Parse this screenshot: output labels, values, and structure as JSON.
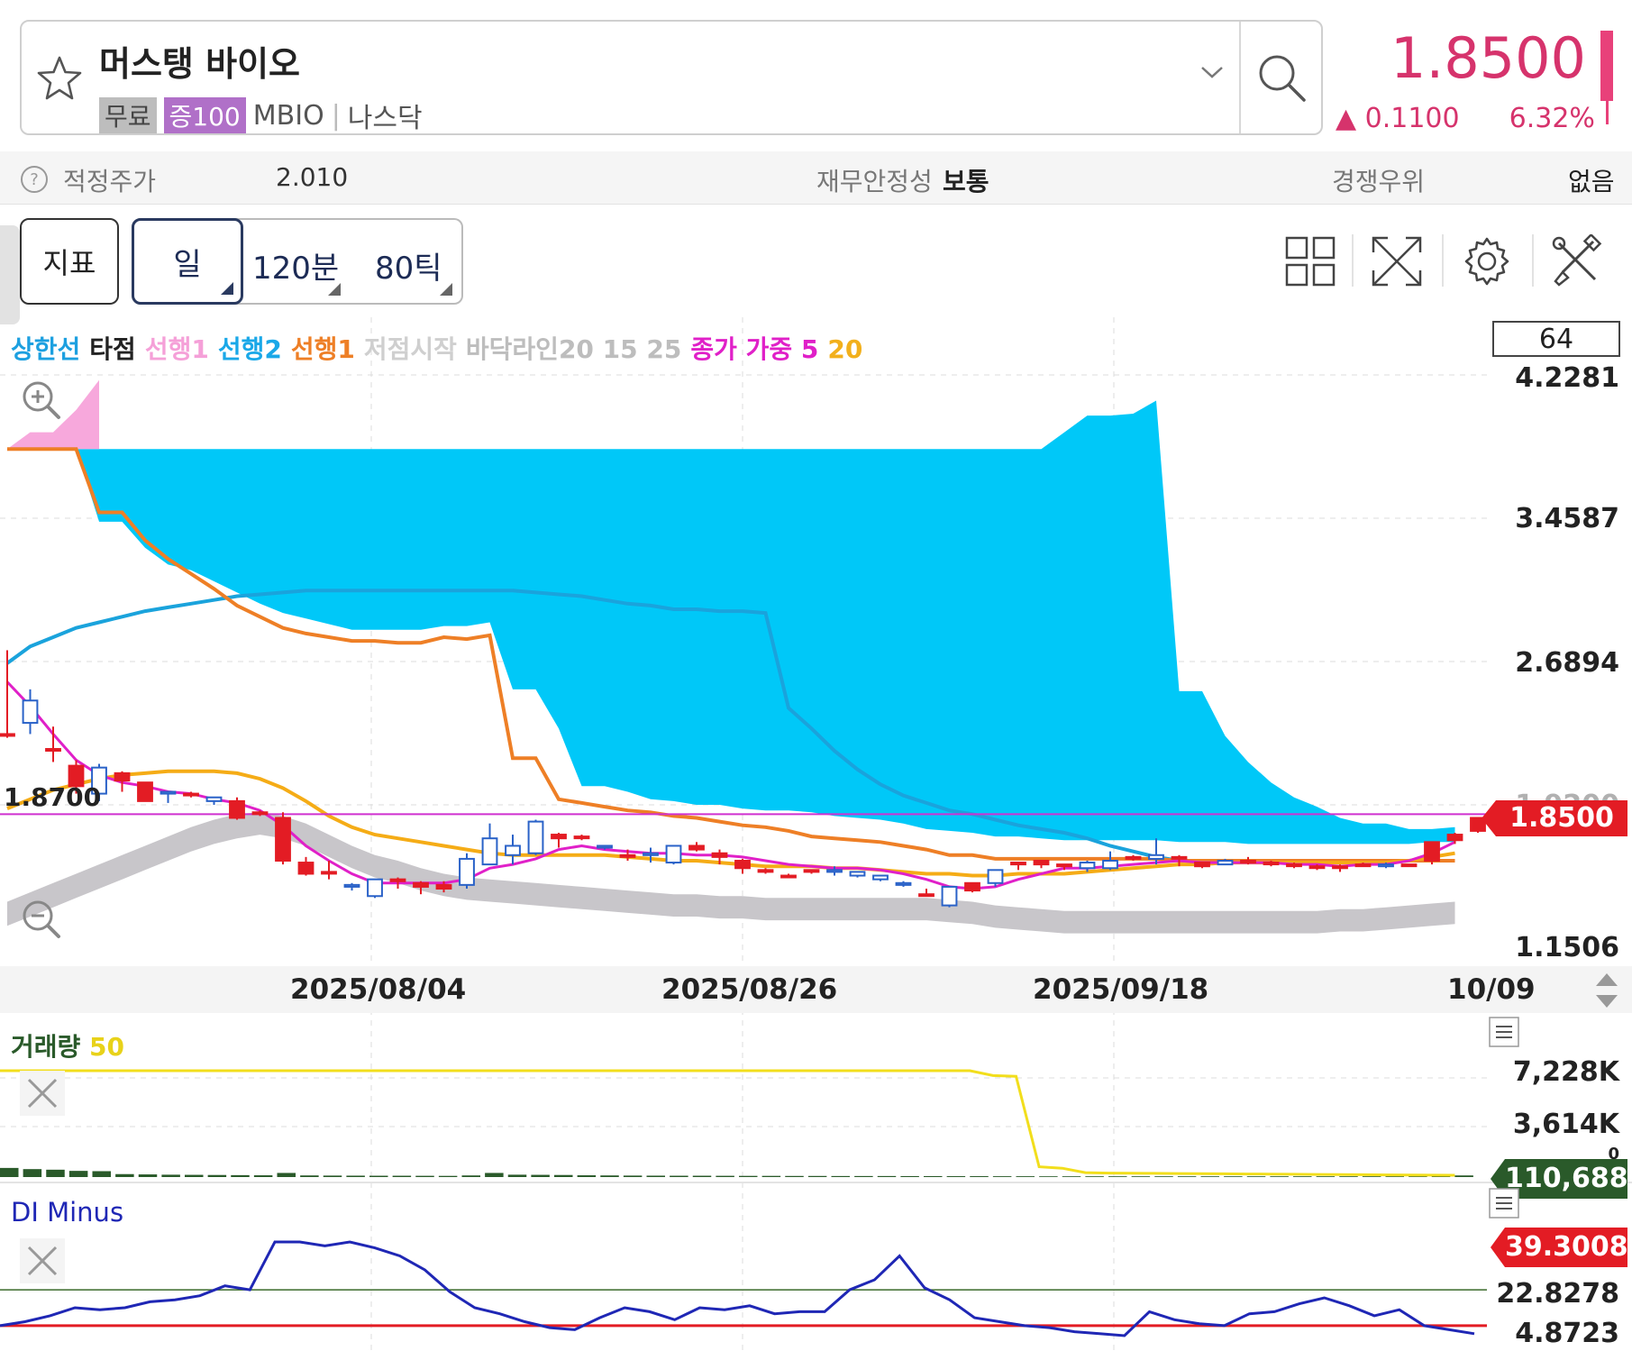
{
  "header": {
    "stock_name": "머스탱 바이오",
    "tag_free": "무료",
    "tag_margin": "증100",
    "ticker": "MBIO",
    "market": "나스닥",
    "price": "1.8500",
    "change_abs": "0.1100",
    "change_pct": "6.32%",
    "up_arrow": "▲",
    "accent_color": "#d6336c"
  },
  "info": {
    "fair_price_label": "적정주가",
    "fair_price_value": "2.010",
    "stability_label": "재무안정성",
    "stability_value": "보통",
    "competitive_label": "경쟁우위",
    "competitive_value": "없음"
  },
  "toolbar": {
    "indicator_label": "지표",
    "day_label": "일",
    "min120_label": "120분",
    "tick80_label": "80틱",
    "icons": [
      "grid-layout-icon",
      "fullscreen-icon",
      "gear-icon",
      "tools-icon"
    ]
  },
  "chart_legend": {
    "upper_limit": "상한선",
    "hit": "타점",
    "lead1_pink": "선행1",
    "lead2": "선행2",
    "lead1_orange": "선행1",
    "low_start": "저점시작",
    "floor_line": "바닥라인20 15 25",
    "close_weighted": "종가 가중 5",
    "ma20": "20"
  },
  "chart_data": [
    {
      "type": "candlestick",
      "count_box": "64",
      "y_ticks": [
        "4.2281",
        "3.4587",
        "2.6894",
        "1.9200",
        "1.1506"
      ],
      "ylim": [
        1.1506,
        4.2281
      ],
      "x_ticks": [
        "2025/08/04",
        "2025/08/26",
        "2025/09/18",
        "10/09"
      ],
      "reference_line": {
        "label": "1.8700",
        "value": 1.87
      },
      "current_price_tag": "1.8500",
      "candles": [
        {
          "o": 2.3,
          "h": 2.75,
          "l": 2.28,
          "c": 2.3
        },
        {
          "o": 2.48,
          "h": 2.54,
          "l": 2.3,
          "c": 2.36
        },
        {
          "o": 2.22,
          "h": 2.34,
          "l": 2.15,
          "c": 2.22
        },
        {
          "o": 2.02,
          "h": 2.16,
          "l": 1.98,
          "c": 2.13
        },
        {
          "o": 2.12,
          "h": 2.14,
          "l": 1.94,
          "c": 1.98
        },
        {
          "o": 2.05,
          "h": 2.1,
          "l": 1.99,
          "c": 2.09
        },
        {
          "o": 1.94,
          "h": 2.04,
          "l": 1.94,
          "c": 2.04
        },
        {
          "o": 1.99,
          "h": 1.99,
          "l": 1.93,
          "c": 1.98
        },
        {
          "o": 1.98,
          "h": 1.99,
          "l": 1.96,
          "c": 1.98
        },
        {
          "o": 1.96,
          "h": 1.96,
          "l": 1.92,
          "c": 1.94
        },
        {
          "o": 1.85,
          "h": 1.96,
          "l": 1.84,
          "c": 1.94
        },
        {
          "o": 1.87,
          "h": 1.89,
          "l": 1.86,
          "c": 1.88
        },
        {
          "o": 1.62,
          "h": 1.88,
          "l": 1.6,
          "c": 1.85
        },
        {
          "o": 1.55,
          "h": 1.64,
          "l": 1.54,
          "c": 1.61
        },
        {
          "o": 1.56,
          "h": 1.62,
          "l": 1.52,
          "c": 1.56
        },
        {
          "o": 1.49,
          "h": 1.5,
          "l": 1.46,
          "c": 1.48
        },
        {
          "o": 1.52,
          "h": 1.52,
          "l": 1.42,
          "c": 1.43
        },
        {
          "o": 1.51,
          "h": 1.53,
          "l": 1.47,
          "c": 1.52
        },
        {
          "o": 1.48,
          "h": 1.51,
          "l": 1.44,
          "c": 1.5
        },
        {
          "o": 1.47,
          "h": 1.51,
          "l": 1.45,
          "c": 1.49
        },
        {
          "o": 1.63,
          "h": 1.66,
          "l": 1.47,
          "c": 1.49
        },
        {
          "o": 1.74,
          "h": 1.82,
          "l": 1.6,
          "c": 1.6
        },
        {
          "o": 1.7,
          "h": 1.76,
          "l": 1.6,
          "c": 1.65
        },
        {
          "o": 1.83,
          "h": 1.84,
          "l": 1.65,
          "c": 1.66
        },
        {
          "o": 1.74,
          "h": 1.77,
          "l": 1.69,
          "c": 1.76
        },
        {
          "o": 1.75,
          "h": 1.76,
          "l": 1.73,
          "c": 1.75
        },
        {
          "o": 1.7,
          "h": 1.7,
          "l": 1.68,
          "c": 1.69
        },
        {
          "o": 1.64,
          "h": 1.68,
          "l": 1.62,
          "c": 1.65
        },
        {
          "o": 1.66,
          "h": 1.69,
          "l": 1.61,
          "c": 1.65
        },
        {
          "o": 1.7,
          "h": 1.7,
          "l": 1.6,
          "c": 1.61
        },
        {
          "o": 1.68,
          "h": 1.72,
          "l": 1.67,
          "c": 1.7
        },
        {
          "o": 1.64,
          "h": 1.68,
          "l": 1.6,
          "c": 1.66
        },
        {
          "o": 1.58,
          "h": 1.63,
          "l": 1.55,
          "c": 1.62
        },
        {
          "o": 1.56,
          "h": 1.58,
          "l": 1.55,
          "c": 1.57
        },
        {
          "o": 1.54,
          "h": 1.55,
          "l": 1.53,
          "c": 1.54
        },
        {
          "o": 1.56,
          "h": 1.57,
          "l": 1.55,
          "c": 1.57
        },
        {
          "o": 1.57,
          "h": 1.59,
          "l": 1.54,
          "c": 1.56
        },
        {
          "o": 1.56,
          "h": 1.56,
          "l": 1.53,
          "c": 1.54
        },
        {
          "o": 1.54,
          "h": 1.54,
          "l": 1.51,
          "c": 1.52
        },
        {
          "o": 1.5,
          "h": 1.51,
          "l": 1.48,
          "c": 1.49
        },
        {
          "o": 1.44,
          "h": 1.47,
          "l": 1.43,
          "c": 1.44
        },
        {
          "o": 1.48,
          "h": 1.48,
          "l": 1.37,
          "c": 1.38
        },
        {
          "o": 1.46,
          "h": 1.5,
          "l": 1.45,
          "c": 1.5
        },
        {
          "o": 1.57,
          "h": 1.57,
          "l": 1.48,
          "c": 1.5
        },
        {
          "o": 1.6,
          "h": 1.61,
          "l": 1.57,
          "c": 1.61
        },
        {
          "o": 1.6,
          "h": 1.62,
          "l": 1.58,
          "c": 1.62
        },
        {
          "o": 1.59,
          "h": 1.6,
          "l": 1.57,
          "c": 1.6
        },
        {
          "o": 1.61,
          "h": 1.62,
          "l": 1.56,
          "c": 1.58
        },
        {
          "o": 1.62,
          "h": 1.67,
          "l": 1.57,
          "c": 1.58
        },
        {
          "o": 1.63,
          "h": 1.65,
          "l": 1.62,
          "c": 1.64
        },
        {
          "o": 1.65,
          "h": 1.74,
          "l": 1.6,
          "c": 1.63
        },
        {
          "o": 1.64,
          "h": 1.65,
          "l": 1.59,
          "c": 1.64
        },
        {
          "o": 1.59,
          "h": 1.61,
          "l": 1.58,
          "c": 1.61
        },
        {
          "o": 1.62,
          "h": 1.63,
          "l": 1.6,
          "c": 1.6
        },
        {
          "o": 1.62,
          "h": 1.64,
          "l": 1.6,
          "c": 1.62
        },
        {
          "o": 1.61,
          "h": 1.62,
          "l": 1.59,
          "c": 1.61
        },
        {
          "o": 1.6,
          "h": 1.61,
          "l": 1.58,
          "c": 1.6
        },
        {
          "o": 1.59,
          "h": 1.6,
          "l": 1.57,
          "c": 1.59
        },
        {
          "o": 1.58,
          "h": 1.6,
          "l": 1.56,
          "c": 1.59
        },
        {
          "o": 1.6,
          "h": 1.61,
          "l": 1.59,
          "c": 1.6
        },
        {
          "o": 1.6,
          "h": 1.61,
          "l": 1.58,
          "c": 1.59
        },
        {
          "o": 1.6,
          "h": 1.6,
          "l": 1.59,
          "c": 1.6
        },
        {
          "o": 1.62,
          "h": 1.7,
          "l": 1.6,
          "c": 1.72
        },
        {
          "o": 1.73,
          "h": 1.77,
          "l": 1.71,
          "c": 1.76
        },
        {
          "o": 1.78,
          "h": 1.85,
          "l": 1.77,
          "c": 1.85
        }
      ],
      "cloud_top": [
        3.83,
        3.83,
        3.83,
        3.83,
        3.83,
        3.83,
        3.83,
        3.83,
        3.83,
        3.83,
        3.83,
        3.83,
        3.83,
        3.83,
        3.83,
        3.83,
        3.83,
        3.83,
        3.83,
        3.83,
        3.83,
        3.83,
        3.83,
        3.83,
        3.83,
        3.83,
        3.83,
        3.83,
        3.83,
        3.83,
        3.83,
        3.83,
        3.83,
        3.83,
        3.83,
        3.83,
        3.83,
        3.83,
        3.83,
        3.83,
        3.83,
        3.83,
        3.83,
        3.83,
        3.83,
        3.83,
        3.92,
        4.01,
        4.01,
        4.02,
        4.09,
        2.53,
        2.53,
        2.29,
        2.15,
        2.04,
        1.96,
        1.91,
        1.85,
        1.82,
        1.82,
        1.79,
        1.79,
        1.8
      ],
      "cloud_bottom": [
        4.02,
        4.1,
        4.19,
        4.24,
        3.44,
        3.44,
        3.3,
        3.21,
        3.18,
        3.12,
        3.06,
        3.0,
        2.95,
        2.92,
        2.89,
        2.86,
        2.86,
        2.86,
        2.86,
        2.88,
        2.88,
        2.9,
        2.54,
        2.54,
        2.33,
        2.02,
        2.02,
        1.99,
        1.95,
        1.94,
        1.92,
        1.92,
        1.9,
        1.89,
        1.89,
        1.88,
        1.86,
        1.85,
        1.84,
        1.82,
        1.79,
        1.78,
        1.77,
        1.75,
        1.75,
        1.74,
        1.73,
        1.73,
        1.73,
        1.73,
        1.73,
        1.72,
        1.72,
        1.72,
        1.71,
        1.71,
        1.71,
        1.71,
        1.71,
        1.71,
        1.71,
        1.71,
        1.72,
        1.72
      ],
      "orange_lead": [
        3.83,
        3.83,
        3.83,
        3.83,
        3.49,
        3.49,
        3.34,
        3.24,
        3.16,
        3.08,
        2.99,
        2.93,
        2.87,
        2.84,
        2.82,
        2.8,
        2.8,
        2.79,
        2.79,
        2.82,
        2.81,
        2.83,
        2.17,
        2.17,
        1.95,
        1.93,
        1.91,
        1.89,
        1.88,
        1.86,
        1.85,
        1.83,
        1.81,
        1.8,
        1.78,
        1.75,
        1.74,
        1.73,
        1.72,
        1.7,
        1.68,
        1.65,
        1.65,
        1.63,
        1.63,
        1.63,
        1.63,
        1.63,
        1.63,
        1.63,
        1.63,
        1.62,
        1.62,
        1.62,
        1.62,
        1.62,
        1.62,
        1.62,
        1.62,
        1.62,
        1.62,
        1.62,
        1.62,
        1.62
      ],
      "pink_lead": [
        3.92,
        3.92,
        3.92,
        4.04,
        4.12
      ],
      "blue_line": [
        2.68,
        2.77,
        2.82,
        2.87,
        2.9,
        2.93,
        2.96,
        2.98,
        3.0,
        3.02,
        3.04,
        3.05,
        3.06,
        3.07,
        3.07,
        3.07,
        3.07,
        3.07,
        3.07,
        3.07,
        3.07,
        3.07,
        3.07,
        3.06,
        3.05,
        3.04,
        3.02,
        3.0,
        2.99,
        2.97,
        2.97,
        2.96,
        2.96,
        2.95,
        2.44,
        2.33,
        2.21,
        2.11,
        2.03,
        1.97,
        1.93,
        1.89,
        1.87,
        1.84,
        1.81,
        1.79,
        1.77,
        1.74,
        1.7,
        1.67,
        1.64,
        1.62,
        1.62,
        1.62,
        1.62,
        1.62,
        1.62,
        1.62,
        1.62,
        1.61,
        1.62,
        1.62,
        1.62,
        1.62
      ],
      "magenta_ma5": [
        2.58,
        2.45,
        2.3,
        2.16,
        2.08,
        2.04,
        2.02,
        1.99,
        1.98,
        1.95,
        1.93,
        1.89,
        1.81,
        1.7,
        1.62,
        1.55,
        1.5,
        1.5,
        1.5,
        1.5,
        1.52,
        1.58,
        1.6,
        1.63,
        1.68,
        1.7,
        1.68,
        1.67,
        1.66,
        1.66,
        1.65,
        1.65,
        1.64,
        1.62,
        1.6,
        1.59,
        1.58,
        1.58,
        1.57,
        1.55,
        1.52,
        1.48,
        1.47,
        1.48,
        1.52,
        1.55,
        1.58,
        1.58,
        1.59,
        1.6,
        1.61,
        1.62,
        1.61,
        1.61,
        1.61,
        1.61,
        1.6,
        1.6,
        1.59,
        1.6,
        1.6,
        1.62,
        1.66,
        1.72
      ],
      "orange_ma20": [
        1.9,
        1.95,
        2.0,
        2.03,
        2.06,
        2.08,
        2.09,
        2.1,
        2.1,
        2.1,
        2.09,
        2.06,
        2.01,
        1.94,
        1.86,
        1.8,
        1.76,
        1.74,
        1.72,
        1.7,
        1.68,
        1.66,
        1.65,
        1.65,
        1.65,
        1.65,
        1.65,
        1.64,
        1.63,
        1.62,
        1.62,
        1.61,
        1.6,
        1.59,
        1.59,
        1.59,
        1.58,
        1.58,
        1.57,
        1.56,
        1.55,
        1.55,
        1.54,
        1.54,
        1.55,
        1.55,
        1.55,
        1.56,
        1.57,
        1.58,
        1.59,
        1.6,
        1.6,
        1.61,
        1.61,
        1.61,
        1.61,
        1.61,
        1.61,
        1.61,
        1.61,
        1.62,
        1.64,
        1.66
      ],
      "gray_band_upper": [
        1.4,
        1.45,
        1.5,
        1.55,
        1.6,
        1.65,
        1.7,
        1.75,
        1.8,
        1.84,
        1.87,
        1.88,
        1.86,
        1.82,
        1.76,
        1.7,
        1.65,
        1.62,
        1.58,
        1.55,
        1.53,
        1.52,
        1.51,
        1.5,
        1.49,
        1.48,
        1.47,
        1.46,
        1.45,
        1.44,
        1.44,
        1.43,
        1.43,
        1.42,
        1.42,
        1.42,
        1.42,
        1.42,
        1.42,
        1.42,
        1.42,
        1.41,
        1.4,
        1.38,
        1.37,
        1.36,
        1.35,
        1.35,
        1.35,
        1.35,
        1.35,
        1.35,
        1.35,
        1.35,
        1.35,
        1.35,
        1.35,
        1.35,
        1.36,
        1.36,
        1.37,
        1.38,
        1.39,
        1.4
      ],
      "gray_band_lower": [
        1.27,
        1.32,
        1.37,
        1.42,
        1.47,
        1.52,
        1.57,
        1.62,
        1.67,
        1.71,
        1.74,
        1.76,
        1.74,
        1.7,
        1.64,
        1.58,
        1.53,
        1.5,
        1.46,
        1.43,
        1.41,
        1.4,
        1.39,
        1.38,
        1.37,
        1.36,
        1.35,
        1.34,
        1.33,
        1.32,
        1.32,
        1.31,
        1.31,
        1.3,
        1.3,
        1.3,
        1.3,
        1.3,
        1.3,
        1.3,
        1.3,
        1.29,
        1.28,
        1.26,
        1.25,
        1.24,
        1.23,
        1.23,
        1.23,
        1.23,
        1.23,
        1.23,
        1.23,
        1.23,
        1.23,
        1.23,
        1.23,
        1.23,
        1.24,
        1.24,
        1.25,
        1.26,
        1.27,
        1.28
      ]
    },
    {
      "type": "bar",
      "title": "거래량",
      "ma_label": "50",
      "y_ticks": [
        "7,228K",
        "3,614K",
        "0"
      ],
      "ylim": [
        0,
        7228
      ],
      "current_tag": "110,688",
      "volume_k": [
        620,
        540,
        500,
        420,
        400,
        200,
        180,
        160,
        150,
        140,
        130,
        120,
        280,
        110,
        100,
        95,
        90,
        90,
        85,
        80,
        110,
        280,
        160,
        150,
        140,
        120,
        110,
        100,
        95,
        90,
        90,
        85,
        80,
        80,
        75,
        75,
        70,
        70,
        70,
        65,
        65,
        60,
        60,
        55,
        55,
        50,
        50,
        50,
        50,
        50,
        50,
        50,
        50,
        50,
        50,
        50,
        50,
        50,
        50,
        50,
        50,
        50,
        140,
        110
      ],
      "ma50_k": [
        7228,
        7228,
        7228,
        7228,
        7228,
        7228,
        7228,
        7228,
        7228,
        7228,
        7228,
        7228,
        7228,
        7228,
        7228,
        7228,
        7228,
        7228,
        7228,
        7228,
        7228,
        7228,
        7228,
        7228,
        7228,
        7228,
        7228,
        7228,
        7228,
        7228,
        7228,
        7228,
        7228,
        7228,
        7228,
        7228,
        7228,
        7228,
        7228,
        7228,
        7228,
        7228,
        7228,
        6900,
        6850,
        700,
        600,
        300,
        270,
        260,
        250,
        240,
        230,
        220,
        210,
        200,
        190,
        180,
        170,
        160,
        150,
        140,
        130,
        120
      ]
    },
    {
      "type": "line",
      "title": "DI Minus",
      "y_ticks": [
        "39.3008",
        "22.8278",
        "4.8723"
      ],
      "current_tag": "39.3008",
      "reference_levels": [
        25,
        7
      ],
      "values": [
        7,
        9,
        12,
        16,
        15,
        16,
        19,
        20,
        22,
        27,
        25,
        49,
        49,
        47,
        49,
        46,
        42,
        35,
        24,
        16,
        13,
        9,
        6,
        5,
        11,
        16,
        14,
        10,
        16,
        15,
        17,
        13,
        14,
        14,
        25,
        30,
        42,
        26,
        20,
        11,
        9,
        7,
        6,
        4,
        3,
        2,
        14,
        10,
        8,
        7,
        13,
        14,
        18,
        21,
        17,
        12,
        15,
        7,
        5,
        3
      ]
    }
  ]
}
